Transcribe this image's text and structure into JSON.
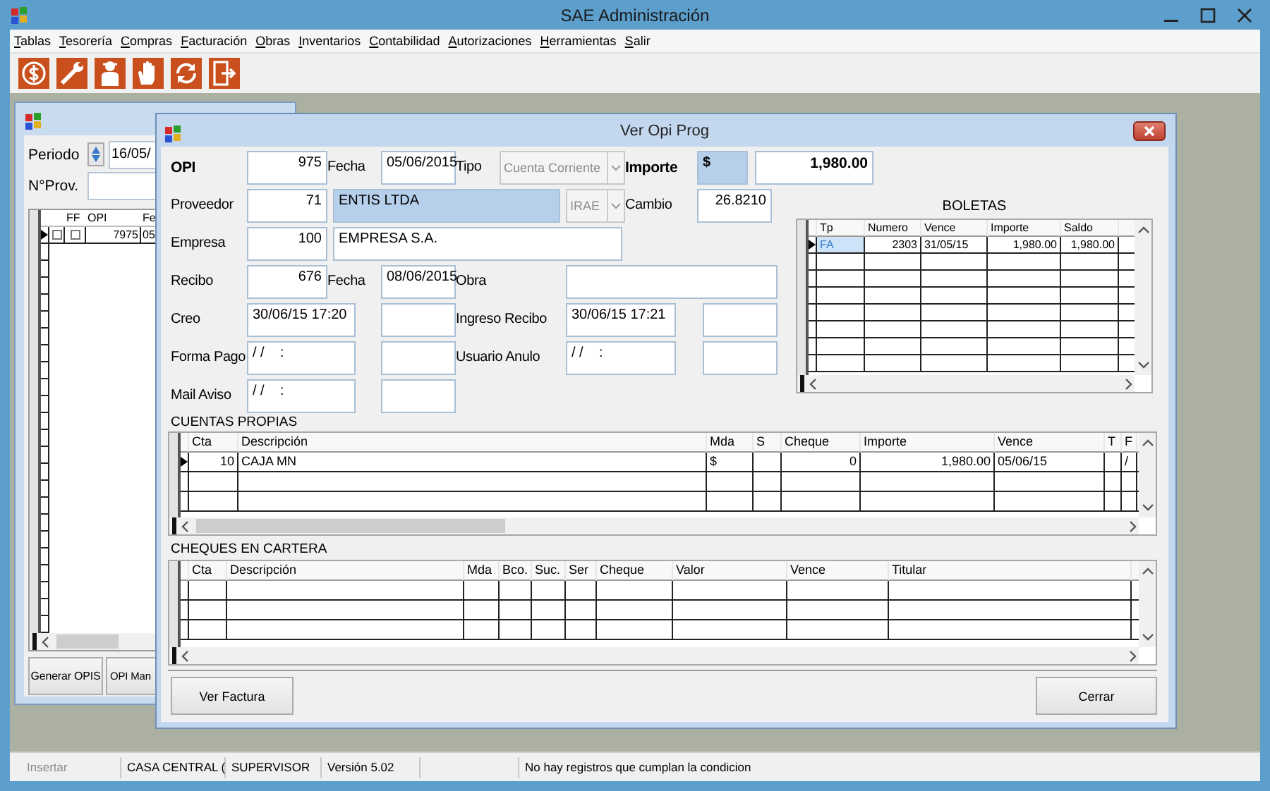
{
  "window": {
    "title": "SAE Administración"
  },
  "menu": [
    "Tablas",
    "Tesorería",
    "Compras",
    "Facturación",
    "Obras",
    "Inventarios",
    "Contabilidad",
    "Autorizaciones",
    "Herramientas",
    "Salir"
  ],
  "background_window": {
    "fields": [
      {
        "label": "Periodo",
        "value": "16/05/"
      },
      {
        "label": "N°Prov."
      }
    ],
    "grid": {
      "columns": [
        "FF",
        "OPI",
        "Fe"
      ],
      "rows": [
        {
          "current": true,
          "select": {
            "checked": false
          },
          "cells": [
            {
              "checked": false
            },
            "7975",
            "05"
          ]
        }
      ]
    },
    "buttons": [
      "Generar OPIS",
      "OPI Man"
    ]
  },
  "dialog": {
    "title": "Ver Opi Prog",
    "form": [
      [
        {
          "kind": "strong",
          "text": "OPI"
        },
        {
          "kind": "number",
          "value": "975"
        },
        {
          "kind": "label",
          "text": "Fecha"
        },
        {
          "kind": "text",
          "value": "05/06/2015"
        },
        {
          "kind": "label",
          "text": "Tipo"
        },
        {
          "kind": "combo",
          "value": "Cuenta Corriente",
          "disabled": true
        },
        {
          "kind": "strong",
          "text": "Importe"
        },
        {
          "kind": "currency",
          "value": "$"
        },
        {
          "kind": "total",
          "value": "1,980.00"
        }
      ],
      [
        {
          "kind": "label",
          "text": "Proveedor"
        },
        {
          "kind": "number",
          "value": "71"
        },
        {
          "kind": "highlight",
          "value": "ENTIS LTDA"
        },
        {
          "kind": "combo",
          "value": "IRAE",
          "disabled": true
        },
        {
          "kind": "label",
          "text": "Cambio"
        },
        {
          "kind": "number",
          "value": "26.8210"
        }
      ],
      [
        {
          "kind": "label",
          "text": "Empresa"
        },
        {
          "kind": "number",
          "value": "100"
        },
        {
          "kind": "text",
          "value": "EMPRESA S.A."
        }
      ],
      [
        {
          "kind": "label",
          "text": "Recibo"
        },
        {
          "kind": "number",
          "value": "676"
        },
        {
          "kind": "label",
          "text": "Fecha"
        },
        {
          "kind": "text",
          "value": "08/06/2015"
        },
        {
          "kind": "label",
          "text": "Obra"
        },
        {
          "kind": "text"
        }
      ],
      [
        {
          "kind": "label",
          "text": "Creo"
        },
        {
          "kind": "text",
          "value": "30/06/15 17:20"
        },
        {
          "kind": "text"
        },
        {
          "kind": "label",
          "text": "Ingreso Recibo"
        },
        {
          "kind": "text",
          "value": "30/06/15 17:21"
        },
        {
          "kind": "text"
        }
      ],
      [
        {
          "kind": "label",
          "text": "Forma Pago"
        },
        {
          "kind": "text",
          "value": "/ /    :"
        },
        {
          "kind": "text"
        },
        {
          "kind": "label",
          "text": "Usuario Anulo"
        },
        {
          "kind": "text",
          "value": "/ /    :"
        },
        {
          "kind": "text"
        }
      ],
      [
        {
          "kind": "label",
          "text": "Mail Aviso"
        },
        {
          "kind": "text",
          "value": "/ /    :"
        },
        {
          "kind": "text"
        }
      ]
    ],
    "boletas": {
      "title": "BOLETAS",
      "columns": [
        "Tp",
        "Numero",
        "Vence",
        "Importe",
        "Saldo"
      ],
      "rows": [
        {
          "current": true,
          "cells": [
            {
              "text": "FA",
              "selected": true
            },
            {
              "text": "2303",
              "selected": false
            },
            {
              "text": "31/05/15",
              "selected": false
            },
            {
              "text": "1,980.00",
              "selected": false
            },
            {
              "text": "1,980.00",
              "selected": false
            }
          ]
        }
      ]
    },
    "cuentas": {
      "title": "CUENTAS PROPIAS",
      "columns": [
        "Cta",
        "Descripción",
        "Mda",
        "S",
        "Cheque",
        "Importe",
        "Vence",
        "T",
        "F"
      ],
      "rows": [
        {
          "current": true,
          "cells": [
            "10",
            "CAJA MN",
            "$",
            null,
            "0",
            "1,980.00",
            "05/06/15",
            null,
            "/"
          ]
        }
      ]
    },
    "cheques": {
      "title": "CHEQUES EN CARTERA",
      "columns": [
        "Cta",
        "Descripción",
        "Mda",
        "Bco.",
        "Suc.",
        "Ser",
        "Cheque",
        "Valor",
        "Vence",
        "Titular"
      ]
    },
    "buttons": [
      "Ver Factura",
      "Cerrar"
    ]
  },
  "status_bar": [
    {
      "text": "Insertar",
      "disabled": true
    },
    {
      "text": "CASA CENTRAL (",
      "disabled": false
    },
    {
      "text": "SUPERVISOR",
      "disabled": false
    },
    {
      "text": "Versión 5.02",
      "disabled": false
    },
    {
      "text": "No hay registros que cumplan la condicion",
      "disabled": false
    }
  ]
}
